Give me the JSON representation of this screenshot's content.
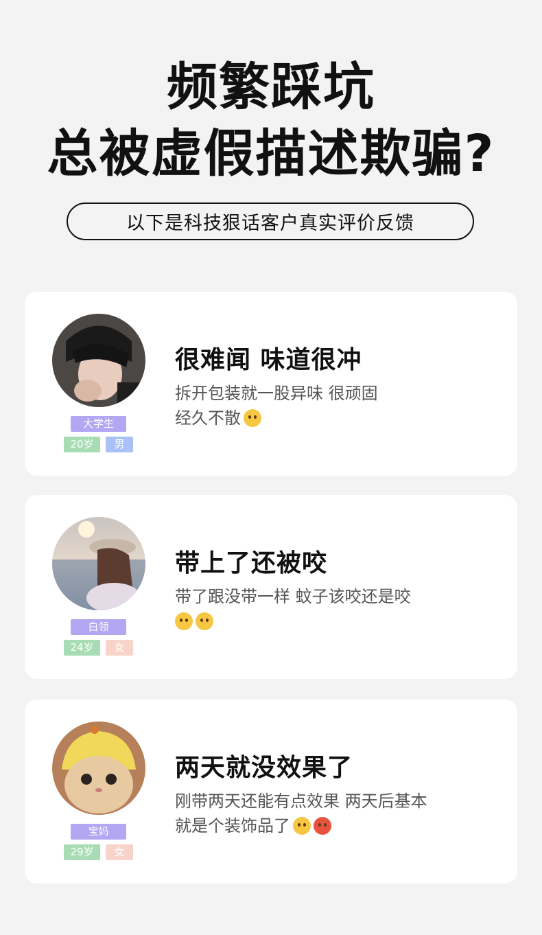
{
  "headline": {
    "line1": "频繁踩坑",
    "line2": "总被虚假描述欺骗?"
  },
  "subtitle": "以下是科技狠话客户真实评价反馈",
  "reviews": [
    {
      "role": "大学生",
      "age": "20岁",
      "gender": "男",
      "gender_color": "#a9c1f6",
      "title": "很难闻 味道很冲",
      "line1": "拆开包装就一股异味 很顽固",
      "line2": "经久不散",
      "emojis": [
        "dizzy-face-icon"
      ]
    },
    {
      "role": "白领",
      "age": "24岁",
      "gender": "女",
      "gender_color": "#f8d3c9",
      "title": "带上了还被咬",
      "line1": "带了跟没带一样 蚊子该咬还是咬",
      "line2": "",
      "emojis": [
        "flushed-face-icon",
        "flushed-face-icon"
      ]
    },
    {
      "role": "宝妈",
      "age": "29岁",
      "gender": "女",
      "gender_color": "#f8d3c9",
      "title": "两天就没效果了",
      "line1": "刚带两天还能有点效果 两天后基本",
      "line2": "就是个装饰品了",
      "emojis": [
        "screaming-face-icon",
        "angry-face-icon"
      ]
    }
  ],
  "colors": {
    "background": "#f3f3f3",
    "card": "#ffffff",
    "role_tag": "#b3a6f2",
    "age_tag": "#a7dcb5"
  }
}
